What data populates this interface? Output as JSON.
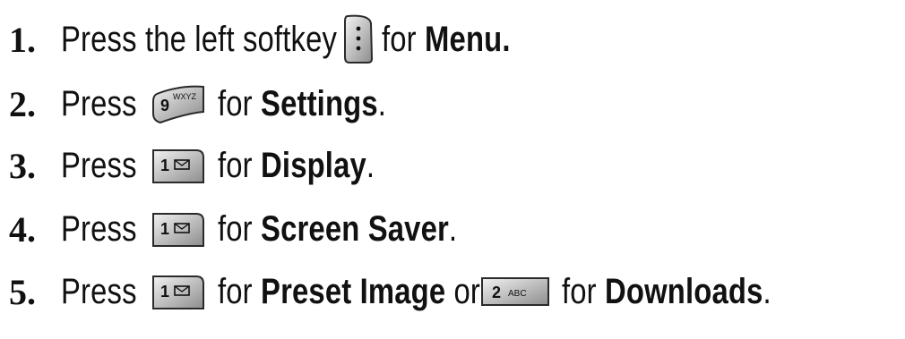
{
  "steps": [
    {
      "number": "1.",
      "text_before": "Press the left softkey",
      "key": "softkey-icon",
      "text_mid": "for",
      "target": "Menu.",
      "text_after": ""
    },
    {
      "number": "2.",
      "text_before": "Press",
      "key": "key-9-wxyz-icon",
      "key_label_main": "9",
      "key_label_sub": "WXYZ",
      "text_mid": "for",
      "target": "Settings",
      "text_after": "."
    },
    {
      "number": "3.",
      "text_before": "Press",
      "key": "key-1-voicemail-icon",
      "key_label_main": "1",
      "text_mid": "for",
      "target": "Display",
      "text_after": "."
    },
    {
      "number": "4.",
      "text_before": "Press",
      "key": "key-1-voicemail-icon",
      "key_label_main": "1",
      "text_mid": "for",
      "target": "Screen Saver",
      "text_after": "."
    },
    {
      "number": "5.",
      "text_before": "Press",
      "key": "key-1-voicemail-icon",
      "key_label_main": "1",
      "text_mid": "for",
      "target": "Preset Image",
      "text_or": "or",
      "key2": "key-2-abc-icon",
      "key2_label_main": "2",
      "key2_label_sub": "ABC",
      "text_mid2": "for",
      "target2": "Downloads",
      "text_after": "."
    }
  ],
  "colors": {
    "text": "#111111",
    "key_face_light": "#f2f2f2",
    "key_face_dark": "#9a9a9a",
    "key_border": "#2a2a2a"
  }
}
